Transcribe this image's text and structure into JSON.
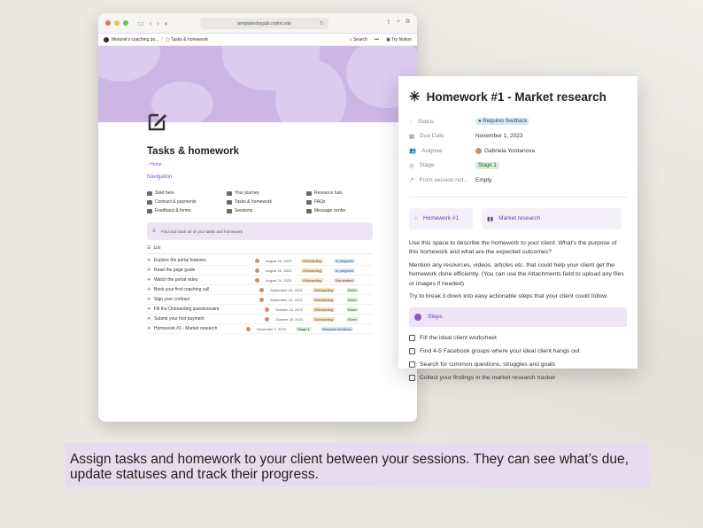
{
  "browser": {
    "url": "templatesbygabi.notion.site",
    "breadcrumb_workspace": "Melanie's coaching po...",
    "breadcrumb_page": "Tasks & homework",
    "search_label": "Search",
    "try_notion_label": "Try Notion"
  },
  "page": {
    "title": "Tasks & homework",
    "crumb": "Home",
    "nav_heading": "Navigation",
    "nav_items": [
      "Start here",
      "Your journey",
      "Resource hub",
      "Contract & payments",
      "Tasks & homework",
      "FAQs",
      "Feedback & forms",
      "Sessions",
      "Message center"
    ],
    "callout_text": "Find and track all of your tasks and homework",
    "list_tab": "List",
    "tasks": [
      {
        "name": "Explore the portal features",
        "date": "August 24, 2023",
        "stage": "Onboarding",
        "status": "In progress",
        "status_class": "ss-prog",
        "stage_class": "st-onb"
      },
      {
        "name": "Read the page guide",
        "date": "August 24, 2023",
        "stage": "Onboarding",
        "status": "In progress",
        "status_class": "ss-prog",
        "stage_class": "st-onb"
      },
      {
        "name": "Watch the portal video",
        "date": "August 24, 2023",
        "stage": "Onboarding",
        "status": "Not started",
        "status_class": "ss-not",
        "stage_class": "st-onb"
      },
      {
        "name": "Book your first coaching call",
        "date": "September 15, 2023",
        "stage": "Onboarding",
        "status": "Done",
        "status_class": "ss-done",
        "stage_class": "st-onb"
      },
      {
        "name": "Sign your contract",
        "date": "September 15, 2023",
        "stage": "Onboarding",
        "status": "Done",
        "status_class": "ss-done",
        "stage_class": "st-onb"
      },
      {
        "name": "Fill the Onboarding questionnaire",
        "date": "October 15, 2023",
        "stage": "Onboarding",
        "status": "Done",
        "status_class": "ss-done",
        "stage_class": "st-onb"
      },
      {
        "name": "Submit your first payment",
        "date": "October 15, 2023",
        "stage": "Onboarding",
        "status": "Done",
        "status_class": "ss-done",
        "stage_class": "st-onb"
      },
      {
        "name": "Homework #1 - Market research",
        "date": "November 1, 2023",
        "stage": "Stage 1",
        "status": "Requires feedback",
        "status_class": "ss-prog",
        "stage_class": "st-s1"
      }
    ]
  },
  "panel": {
    "title": "Homework #1 - Market research",
    "props": [
      {
        "key": "Status",
        "value": "Requires feedback"
      },
      {
        "key": "Due Date",
        "value": "November 1, 2023"
      },
      {
        "key": "Asignee",
        "value": "Gabriela Yordanova"
      },
      {
        "key": "Stage",
        "value": "Stage 1"
      },
      {
        "key": "From session not...",
        "value": "Empty"
      }
    ],
    "relations": [
      "Homework #1",
      "Market research"
    ],
    "paragraphs": [
      "Use this space to describe the homework to your client. What's the purpose of this homework and what are the expected outcomes?",
      "Mention any resources, videos, articles etc. that could help your client get the homework done efficiently. (You can use the Attachments field to upload any files or images if needed)",
      "Try to break it down into easy actionable steps that your client could follow."
    ],
    "steps_label": "Steps",
    "todos": [
      "Fill the ideal client worksheet",
      "Find 4-5 Facebook groups where your ideal client hangs out",
      "Search for common questions, struggles and goals",
      "Collect your findings in the market research tracker"
    ]
  },
  "caption": "Assign tasks and homework to your client between your sessions. They can see what’s due, update statuses and track their progress.",
  "colors": {
    "accent": "#8a56c2",
    "cover": "#cdb6e6",
    "caption_bg": "#e7dcef"
  }
}
